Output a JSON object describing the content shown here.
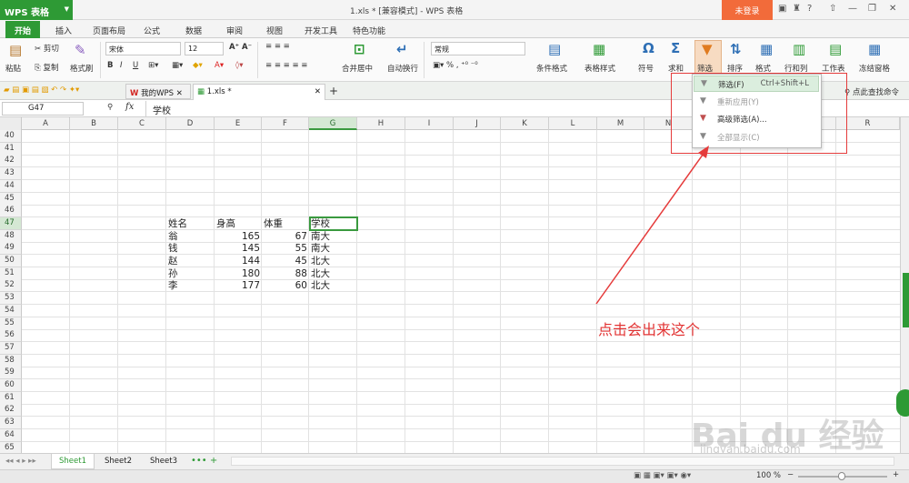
{
  "titlebar": {
    "app_name": "WPS 表格",
    "title": "1.xls * [兼容模式] - WPS 表格",
    "login": "未登录"
  },
  "menu": [
    "开始",
    "插入",
    "页面布局",
    "公式",
    "数据",
    "审阅",
    "视图",
    "开发工具",
    "特色功能"
  ],
  "ribbon": {
    "paste": "粘贴",
    "cut": "剪切",
    "copy": "复制",
    "format_painter": "格式刷",
    "font": "宋体",
    "size": "12",
    "merge": "合并居中",
    "wrap": "自动换行",
    "numfmt": "常规",
    "cond_fmt": "条件格式",
    "table_fmt": "表格样式",
    "symbol": "符号",
    "sum": "求和",
    "filter": "筛选",
    "sort": "排序",
    "format": "格式",
    "rowcol": "行和列",
    "sheet": "工作表",
    "freeze": "冻结窗格",
    "find_cmd": "点此查找命令"
  },
  "doctabs": {
    "tab1": "我的WPS",
    "tab2": "1.xls *"
  },
  "formula": {
    "cell_ref": "G47",
    "fx": "fx",
    "content": "学校"
  },
  "columns": [
    "A",
    "B",
    "C",
    "D",
    "E",
    "F",
    "G",
    "H",
    "I",
    "J",
    "K",
    "L",
    "M",
    "N",
    "O",
    "P",
    "Q",
    "R"
  ],
  "rows": [
    "40",
    "41",
    "42",
    "43",
    "44",
    "45",
    "46",
    "47",
    "48",
    "49",
    "50",
    "51",
    "52",
    "53",
    "54",
    "55",
    "56",
    "57",
    "58",
    "59",
    "60",
    "61",
    "62",
    "63",
    "64",
    "65"
  ],
  "table": {
    "headers": [
      "姓名",
      "身高",
      "体重",
      "学校"
    ],
    "records": [
      [
        "翁",
        "165",
        "67",
        "南大"
      ],
      [
        "钱",
        "145",
        "55",
        "南大"
      ],
      [
        "赵",
        "144",
        "45",
        "北大"
      ],
      [
        "孙",
        "180",
        "88",
        "北大"
      ],
      [
        "李",
        "177",
        "60",
        "北大"
      ]
    ]
  },
  "dropdown": {
    "items": [
      {
        "label": "筛选(F)",
        "shortcut": "Ctrl+Shift+L"
      },
      {
        "label": "重新应用(Y)",
        "shortcut": ""
      },
      {
        "label": "高级筛选(A)...",
        "shortcut": ""
      },
      {
        "label": "全部显示(C)",
        "shortcut": ""
      }
    ]
  },
  "annotation": "点击会出来这个",
  "sheets": [
    "Sheet1",
    "Sheet2",
    "Sheet3"
  ],
  "status": {
    "zoom": "100 %"
  },
  "watermark": {
    "main": "Bai du 经验",
    "sub": "jingyan.baidu.com"
  },
  "colors": {
    "accent": "#2e9a35",
    "login": "#f26b3a",
    "annotation": "#e23333"
  }
}
